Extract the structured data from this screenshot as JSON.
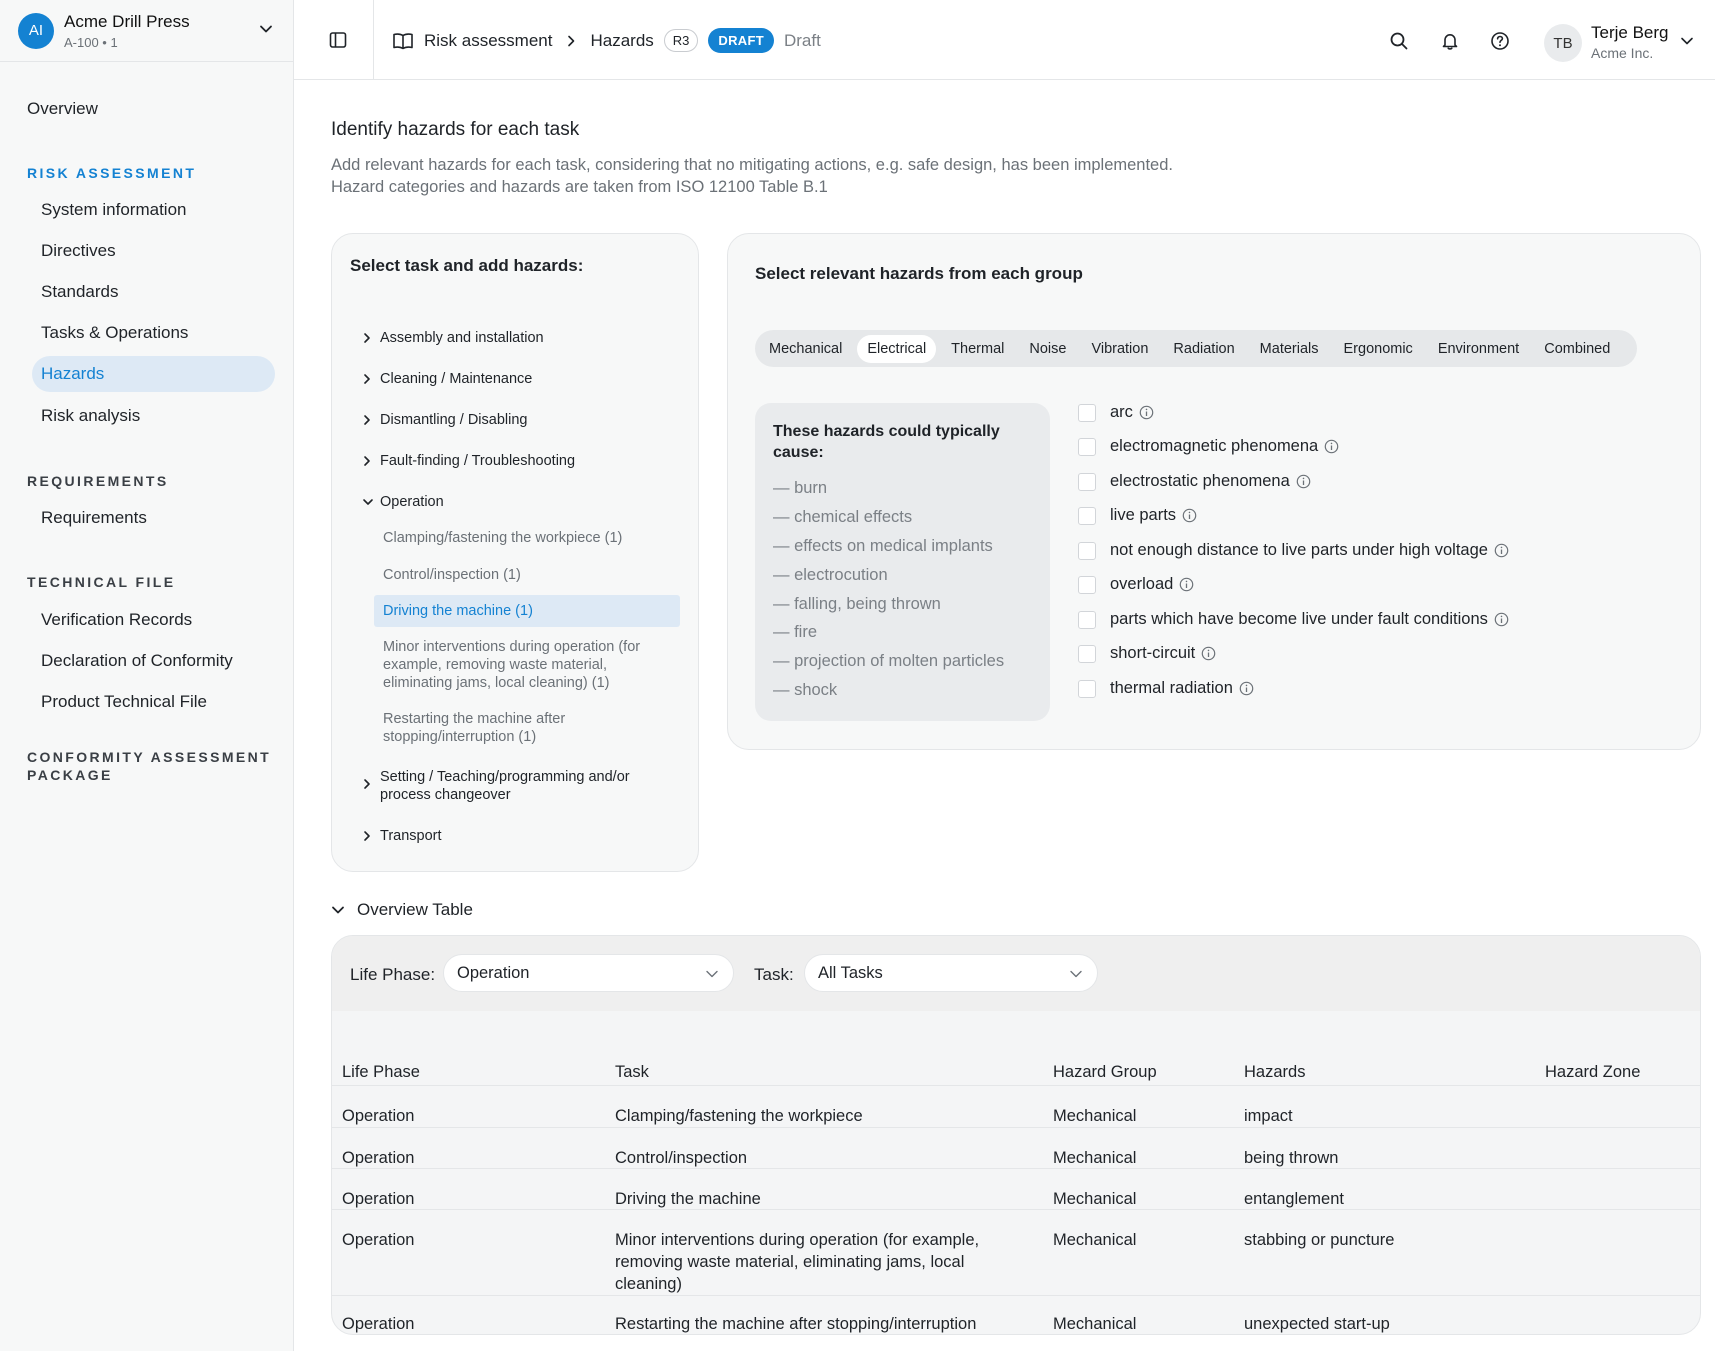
{
  "project": {
    "avatar": "AI",
    "name": "Acme Drill Press",
    "sub": "A-100 • 1"
  },
  "sidebar": {
    "overview": "Overview",
    "sections": [
      {
        "heading": "RISK ASSESSMENT",
        "items": [
          "System information",
          "Directives",
          "Standards",
          "Tasks & Operations",
          "Hazards",
          "Risk analysis"
        ]
      },
      {
        "heading": "REQUIREMENTS",
        "items": [
          "Requirements"
        ]
      },
      {
        "heading": "TECHNICAL FILE",
        "items": [
          "Verification Records",
          "Declaration of Conformity",
          "Product Technical File"
        ]
      },
      {
        "heading": "CONFORMITY ASSESSMENT PACKAGE",
        "items": []
      }
    ],
    "active_item": "Hazards"
  },
  "header": {
    "breadcrumb_root": "Risk assessment",
    "breadcrumb_current": "Hazards",
    "revision": "R3",
    "status_badge": "DRAFT",
    "status_text": "Draft",
    "user_initials": "TB",
    "user_name": "Terje Berg",
    "user_org": "Acme Inc."
  },
  "page": {
    "title": "Identify hazards for each task",
    "desc_line1": "Add relevant hazards for each task, considering that no mitigating actions, e.g. safe design, has been implemented.",
    "desc_line2": "Hazard categories and hazards are taken from ISO 12100 Table B.1"
  },
  "task_panel": {
    "title": "Select task and add hazards:",
    "groups": [
      "Assembly and installation",
      "Cleaning / Maintenance",
      "Dismantling / Disabling",
      "Fault-finding / Troubleshooting",
      "Operation",
      "Setting / Teaching/programming and/or process changeover",
      "Transport"
    ],
    "operation_tasks": [
      "Clamping/fastening the workpiece (1)",
      "Control/inspection (1)",
      "Driving the machine (1)",
      "Minor interventions during operation (for example, removing waste material, eliminating jams, local cleaning) (1)",
      "Restarting the machine after stopping/interruption (1)"
    ],
    "selected_task": "Driving the machine (1)"
  },
  "hazard_panel": {
    "title": "Select relevant hazards from each group",
    "tabs": [
      "Mechanical",
      "Electrical",
      "Thermal",
      "Noise",
      "Vibration",
      "Radiation",
      "Materials",
      "Ergonomic",
      "Environment",
      "Combined"
    ],
    "active_tab": "Electrical",
    "causes_title": "These hazards could typically cause:",
    "causes": [
      "— burn",
      "— chemical effects",
      "— effects on medical implants",
      "— electrocution",
      "— falling, being thrown",
      "— fire",
      "— projection of molten particles",
      "— shock"
    ],
    "hazards": [
      "arc",
      "electromagnetic phenomena",
      "electrostatic phenomena",
      "live parts",
      "not enough distance to live parts under high voltage",
      "overload",
      "parts which have become live under fault conditions",
      "short-circuit",
      "thermal radiation"
    ]
  },
  "overview": {
    "toggle_label": "Overview Table",
    "life_phase_label": "Life Phase:",
    "life_phase_value": "Operation",
    "task_label": "Task:",
    "task_value": "All Tasks",
    "columns": [
      "Life Phase",
      "Task",
      "Hazard Group",
      "Hazards",
      "Hazard Zone"
    ],
    "rows": [
      [
        "Operation",
        "Clamping/fastening the workpiece",
        "Mechanical",
        "impact",
        ""
      ],
      [
        "Operation",
        "Control/inspection",
        "Mechanical",
        "being thrown",
        ""
      ],
      [
        "Operation",
        "Driving the machine",
        "Mechanical",
        "entanglement",
        ""
      ],
      [
        "Operation",
        "Minor interventions during operation (for example, removing waste material, eliminating jams, local cleaning)",
        "Mechanical",
        "stabbing or puncture",
        ""
      ],
      [
        "Operation",
        "Restarting the machine after stopping/interruption",
        "Mechanical",
        "unexpected start-up",
        ""
      ]
    ]
  },
  "colors": {
    "accent": "#1482d2",
    "active_bg": "#dde9f5"
  }
}
